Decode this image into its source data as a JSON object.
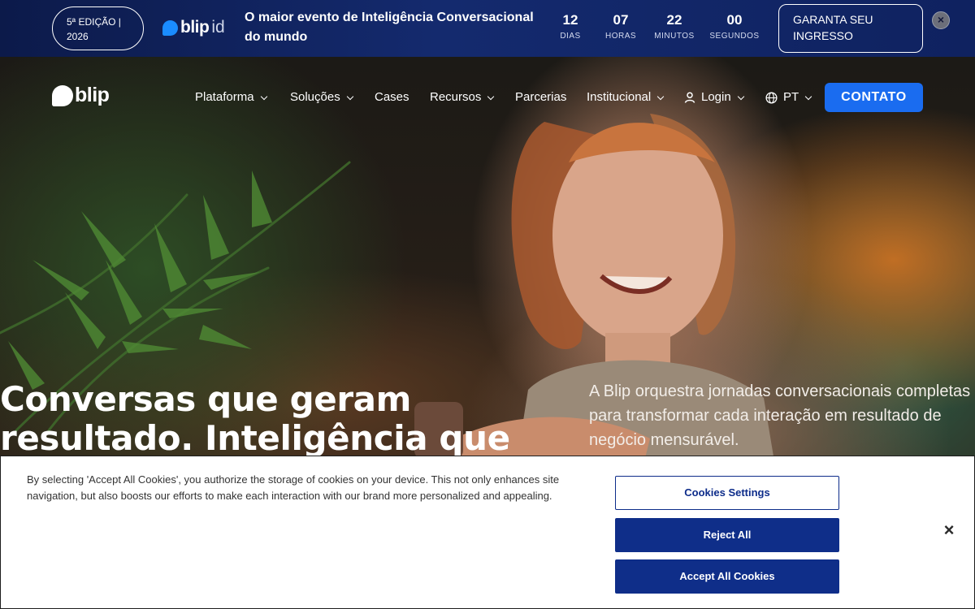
{
  "promo": {
    "edition": "5ª EDIÇÃO | 2026",
    "logo_word": "blip",
    "logo_suffix": "id",
    "headline": "O maior evento de Inteligência Conversacional do mundo",
    "countdown": [
      {
        "value": "12",
        "label": "DIAS"
      },
      {
        "value": "07",
        "label": "HORAS"
      },
      {
        "value": "22",
        "label": "MINUTOS"
      },
      {
        "value": "00",
        "label": "SEGUNDOS"
      }
    ],
    "ticket_button": "GARANTA SEU INGRESSO",
    "close_icon": "close-icon"
  },
  "nav": {
    "logo_word": "blip",
    "items": [
      {
        "label": "Plataforma",
        "dropdown": true
      },
      {
        "label": "Soluções",
        "dropdown": true
      },
      {
        "label": "Cases",
        "dropdown": false
      },
      {
        "label": "Recursos",
        "dropdown": true
      },
      {
        "label": "Parcerias",
        "dropdown": false
      },
      {
        "label": "Institucional",
        "dropdown": true
      }
    ],
    "login": {
      "label": "Login",
      "icon": "user-icon"
    },
    "language": {
      "label": "PT",
      "icon": "globe-icon"
    },
    "contact_button": "CONTATO"
  },
  "hero": {
    "title": "Conversas que geram resultado. Inteligência que",
    "subtitle": "A Blip orquestra jornadas conversacionais completas para transformar cada interação em resultado de negócio mensurável."
  },
  "cookie_banner": {
    "text": "By selecting 'Accept All Cookies', you authorize the storage of cookies on your device. This not only enhances site navigation, but also boosts our efforts to make each interaction with our brand more personalized and appealing.",
    "settings_button": "Cookies Settings",
    "reject_button": "Reject All",
    "accept_button": "Accept All Cookies",
    "close_symbol": "×"
  },
  "colors": {
    "promo_bg": "#0c1a4a",
    "accent_blue": "#1a6cf0",
    "cookie_button": "#0f2e89"
  }
}
